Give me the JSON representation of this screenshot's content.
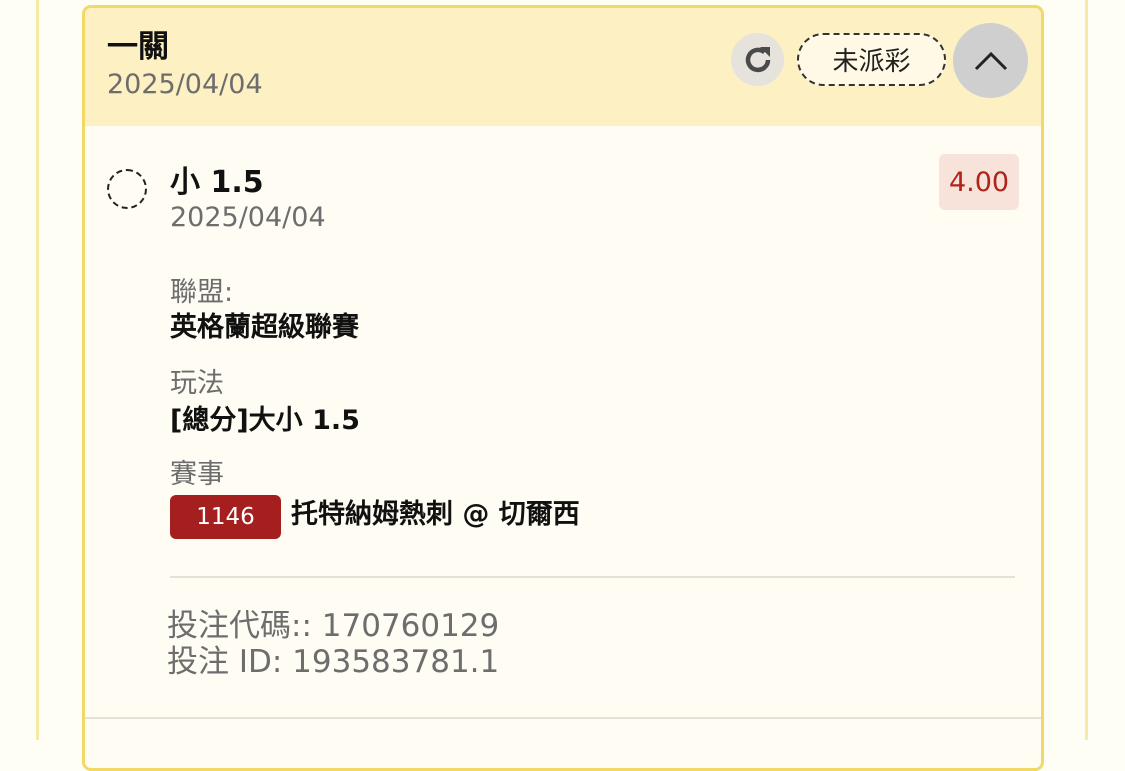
{
  "header": {
    "title": "一關",
    "date": "2025/04/04",
    "status": "未派彩"
  },
  "bet": {
    "selection": "小 1.5",
    "date": "2025/04/04",
    "odds": "4.00",
    "league_label": "聯盟:",
    "league_value": "英格蘭超級聯賽",
    "market_label": "玩法",
    "market_value": "[總分]大小 1.5",
    "event_label": "賽事",
    "event_id": "1146",
    "event_name": "托特納姆熱刺 @ 切爾西",
    "bet_code": "投注代碼:: 170760129",
    "bet_id": "投注 ID: 193583781.1"
  },
  "icons": {
    "refresh": "refresh-icon",
    "collapse": "chevron-up-icon"
  },
  "colors": {
    "header_bg": "#fdf0c2",
    "card_border": "#f2d865",
    "odds_text": "#b0241a",
    "event_badge_bg": "#a51f1f"
  }
}
